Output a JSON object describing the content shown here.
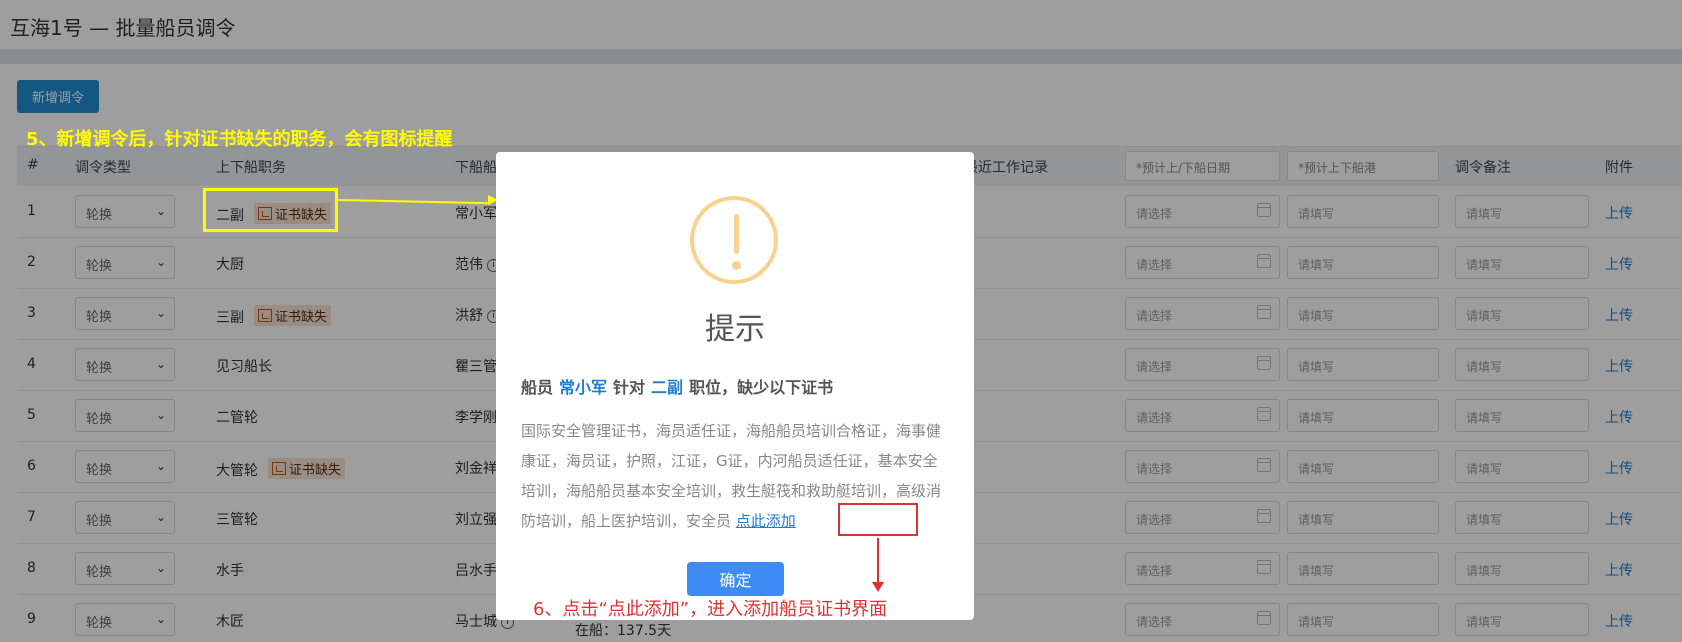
{
  "window": {
    "title": "互海1号 — 批量船员调令"
  },
  "toolbar": {
    "add_label": "新增调令"
  },
  "annotations": {
    "step5": "5、新增调令后，针对证书缺失的职务，会有图标提醒",
    "step6": "6、点击“点此添加”，进入添加船员证书界面"
  },
  "table": {
    "headers": {
      "index": "#",
      "type": "调令类型",
      "position": "上下船职务",
      "off": "下船船员",
      "records": "最近工作记录",
      "date_placeholder": "*预计上/下船日期",
      "port_placeholder": "*预计上下船港",
      "remark": "调令备注",
      "attach": "附件"
    },
    "select_value": "轮换",
    "date_input_placeholder": "请选择",
    "text_input_placeholder": "请填写",
    "upload_label": "上传",
    "rows": [
      {
        "no": "1",
        "position": "二副",
        "badge": "证书缺失",
        "off": "常小军"
      },
      {
        "no": "2",
        "position": "大厨",
        "badge": "",
        "off": "范伟"
      },
      {
        "no": "3",
        "position": "三副",
        "badge": "证书缺失",
        "off": "洪舒"
      },
      {
        "no": "4",
        "position": "见习船长",
        "badge": "",
        "off": "瞿三管"
      },
      {
        "no": "5",
        "position": "二管轮",
        "badge": "",
        "off": "李学刚"
      },
      {
        "no": "6",
        "position": "大管轮",
        "badge": "证书缺失",
        "off": "刘金祥"
      },
      {
        "no": "7",
        "position": "三管轮",
        "badge": "",
        "off": "刘立强"
      },
      {
        "no": "8",
        "position": "水手",
        "badge": "",
        "off": "吕水手"
      },
      {
        "no": "9",
        "position": "木匠",
        "badge": "",
        "off": "马士城"
      }
    ],
    "footer_text": "在船：137.5天"
  },
  "modal": {
    "title": "提示",
    "heading_prefix": "船员",
    "crew_name": "常小军",
    "heading_mid": "针对",
    "position": "二副",
    "heading_suffix": "职位，缺少以下证书",
    "certs": "国际安全管理证书，海员适任证，海船船员培训合格证，海事健康证，海员证，护照，江证，G证，内河船员适任证，基本安全培训，海船船员基本安全培训，救生艇筏和救助艇培训，高级消防培训，船上医护培训，安全员",
    "add_link": "点此添加",
    "ok_label": "确定"
  },
  "colors": {
    "accent": "#1e8fd1",
    "link": "#1e7ed2",
    "warning": "#f7d28f",
    "annotation_yellow": "#fffc00",
    "annotation_red": "#e23030"
  }
}
